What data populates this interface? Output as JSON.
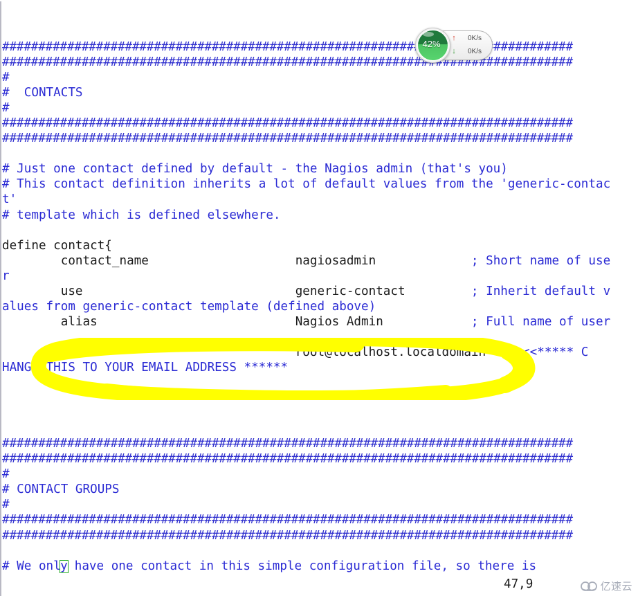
{
  "editor": {
    "lines": [
      {
        "segments": [
          {
            "text": "###############################################################################",
            "cls": "hashline"
          }
        ]
      },
      {
        "segments": [
          {
            "text": "###############################################################################",
            "cls": "hashline"
          }
        ]
      },
      {
        "segments": [
          {
            "text": "#",
            "cls": "cmt"
          }
        ]
      },
      {
        "segments": [
          {
            "text": "#  CONTACTS",
            "cls": "cmt"
          }
        ]
      },
      {
        "segments": [
          {
            "text": "#",
            "cls": "cmt"
          }
        ]
      },
      {
        "segments": [
          {
            "text": "###############################################################################",
            "cls": "hashline"
          }
        ]
      },
      {
        "segments": [
          {
            "text": "###############################################################################",
            "cls": "hashline"
          }
        ]
      },
      {
        "segments": [
          {
            "text": "",
            "cls": "cmt"
          }
        ]
      },
      {
        "segments": [
          {
            "text": "# Just one contact defined by default - the Nagios admin (that's you)",
            "cls": "cmt"
          }
        ]
      },
      {
        "segments": [
          {
            "text": "# This contact definition inherits a lot of default values from the 'generic-contac",
            "cls": "cmt"
          }
        ]
      },
      {
        "segments": [
          {
            "text": "t'",
            "cls": "cmt"
          }
        ]
      },
      {
        "segments": [
          {
            "text": "# template which is defined elsewhere.",
            "cls": "cmt"
          }
        ]
      },
      {
        "segments": [
          {
            "text": "",
            "cls": "cmt"
          }
        ]
      },
      {
        "segments": [
          {
            "text": "define contact{",
            "cls": "blk"
          }
        ]
      },
      {
        "segments": [
          {
            "text": "        contact_name                    nagiosadmin             ",
            "cls": "blk"
          },
          {
            "text": "; Short name of use",
            "cls": "cmt"
          }
        ]
      },
      {
        "segments": [
          {
            "text": "r",
            "cls": "cmt"
          }
        ]
      },
      {
        "segments": [
          {
            "text": "        use                             generic-contact         ",
            "cls": "blk"
          },
          {
            "text": "; Inherit default v",
            "cls": "cmt"
          }
        ]
      },
      {
        "segments": [
          {
            "text": "alues from generic-contact template (defined above)",
            "cls": "cmt"
          }
        ]
      },
      {
        "segments": [
          {
            "text": "        alias                           Nagios Admin            ",
            "cls": "blk"
          },
          {
            "text": "; Full name of user",
            "cls": "cmt"
          }
        ]
      },
      {
        "segments": [
          {
            "text": "",
            "cls": "cmt"
          }
        ]
      },
      {
        "segments": [
          {
            "text": "        email                           root@localhost.localdomain   ",
            "cls": "blk"
          },
          {
            "text": "; <<***** C",
            "cls": "cmt"
          }
        ]
      },
      {
        "segments": [
          {
            "text": "HANGE THIS TO YOUR EMAIL ADDRESS ******",
            "cls": "cmt"
          }
        ]
      },
      {
        "segments": [
          {
            "text": "        }",
            "cls": "blk"
          }
        ]
      },
      {
        "segments": [
          {
            "text": "",
            "cls": "cmt"
          }
        ]
      },
      {
        "segments": [
          {
            "text": "",
            "cls": "cmt"
          }
        ]
      },
      {
        "segments": [
          {
            "text": "",
            "cls": "cmt"
          }
        ]
      },
      {
        "segments": [
          {
            "text": "###############################################################################",
            "cls": "hashline"
          }
        ]
      },
      {
        "segments": [
          {
            "text": "###############################################################################",
            "cls": "hashline"
          }
        ]
      },
      {
        "segments": [
          {
            "text": "#",
            "cls": "cmt"
          }
        ]
      },
      {
        "segments": [
          {
            "text": "# CONTACT GROUPS",
            "cls": "cmt"
          }
        ]
      },
      {
        "segments": [
          {
            "text": "#",
            "cls": "cmt"
          }
        ]
      },
      {
        "segments": [
          {
            "text": "###############################################################################",
            "cls": "hashline"
          }
        ]
      },
      {
        "segments": [
          {
            "text": "###############################################################################",
            "cls": "hashline"
          }
        ]
      },
      {
        "segments": [
          {
            "text": "",
            "cls": "cmt"
          }
        ]
      },
      {
        "segments": [
          {
            "text": "# We on",
            "cls": "cmt"
          },
          {
            "text": "l",
            "cls": "cmt"
          },
          {
            "text": "y",
            "cls": "cmt",
            "cursor": true
          },
          {
            "text": " have one contact in this simple configuration file, so there is",
            "cls": "cmt"
          }
        ]
      }
    ],
    "cursor_char": "y",
    "cursor_color": "#1faa1f",
    "comment_color": "#2b2bd4",
    "code_color": "#1b1b1b",
    "background_color": "#ffffff"
  },
  "annotation": {
    "type": "hand-drawn-ellipse",
    "color": "#ffff00",
    "target_text": "email  root@localhost.localdomain"
  },
  "widget": {
    "percent_label": "42%",
    "percent_value": 42,
    "upload_speed": "0K/s",
    "download_speed": "0K/s",
    "ball_color": "#2a9b4c",
    "up_arrow": "↑",
    "down_arrow": "↓"
  },
  "status_bar": {
    "ruler": "47,9"
  },
  "watermark": {
    "text": "亿速云"
  }
}
